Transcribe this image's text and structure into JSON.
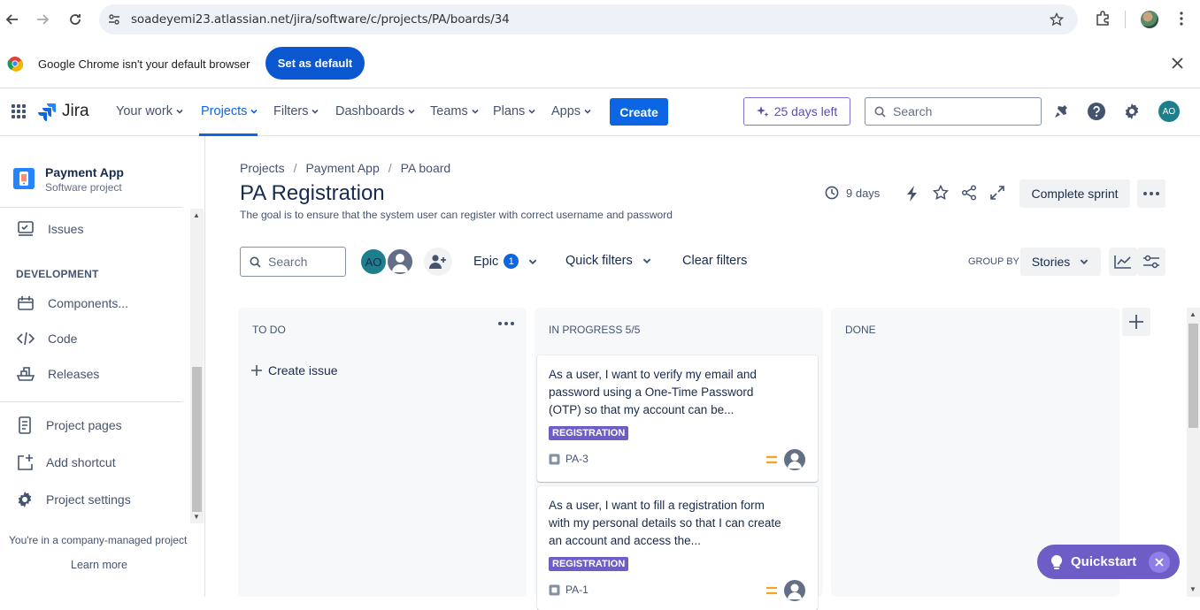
{
  "browser": {
    "url": "soadeyemi23.atlassian.net/jira/software/c/projects/PA/boards/34",
    "banner_text": "Google Chrome isn't your default browser",
    "set_default_label": "Set as default"
  },
  "topnav": {
    "product": "Jira",
    "items": [
      "Your work",
      "Projects",
      "Filters",
      "Dashboards",
      "Teams",
      "Plans",
      "Apps"
    ],
    "active": "Projects",
    "create_label": "Create",
    "trial_label": "25 days left",
    "search_placeholder": "Search",
    "user_initials": "AO",
    "accent": "#0c66e4"
  },
  "sidebar": {
    "project_name": "Payment App",
    "project_type": "Software project",
    "issues_label": "Issues",
    "dev_heading": "DEVELOPMENT",
    "dev_items": [
      "Components...",
      "Code",
      "Releases"
    ],
    "bottom_items": [
      "Project pages",
      "Add shortcut",
      "Project settings"
    ],
    "footer_text": "You're in a company-managed project",
    "learn_more": "Learn more"
  },
  "main": {
    "breadcrumb": [
      "Projects",
      "Payment App",
      "PA board"
    ],
    "sprint_title": "PA Registration",
    "sprint_goal": "The goal is to ensure that the system user can register with correct username and password",
    "days_remaining": "9 days",
    "complete_sprint_label": "Complete sprint",
    "search_placeholder": "Search",
    "avatar_initials": "AO",
    "epic_label": "Epic",
    "epic_count": "1",
    "quick_filters_label": "Quick filters",
    "clear_filters_label": "Clear filters",
    "group_by_label": "GROUP BY",
    "group_by_value": "Stories"
  },
  "board": {
    "columns": [
      {
        "title": "TO DO",
        "create_label": "Create issue"
      },
      {
        "title": "IN PROGRESS 5/5"
      },
      {
        "title": "DONE"
      }
    ],
    "cards": [
      {
        "summary": "As a user, I want to verify my email and password using a One-Time Password (OTP) so that my account can be...",
        "label": "REGISTRATION",
        "key": "PA-3"
      },
      {
        "summary": "As a user, I want to fill a registration form with my personal details so that I can create an account and access the...",
        "label": "REGISTRATION",
        "key": "PA-1"
      }
    ],
    "label_color": "#6e5dc6",
    "priority_color": "#f5a623"
  },
  "quickstart": {
    "label": "Quickstart"
  }
}
